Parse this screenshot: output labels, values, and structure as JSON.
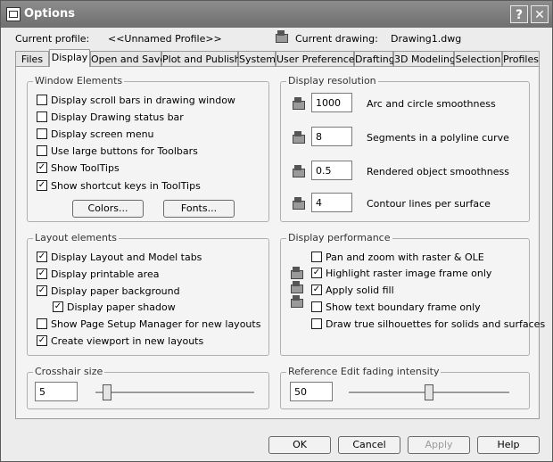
{
  "window": {
    "title": "Options",
    "help_glyph": "?",
    "close_glyph": "✕"
  },
  "header": {
    "profile_label": "Current profile:",
    "profile_value": "<<Unnamed Profile>>",
    "drawing_label": "Current drawing:",
    "drawing_value": "Drawing1.dwg"
  },
  "tabs": [
    "Files",
    "Display",
    "Open and Save",
    "Plot and Publish",
    "System",
    "User Preferences",
    "Drafting",
    "3D Modeling",
    "Selection",
    "Profiles"
  ],
  "active_tab": "Display",
  "window_elements": {
    "title": "Window Elements",
    "items": [
      {
        "label": "Display scroll bars in drawing window",
        "checked": false
      },
      {
        "label": "Display Drawing status bar",
        "checked": false
      },
      {
        "label": "Display screen menu",
        "checked": false
      },
      {
        "label": "Use large buttons for Toolbars",
        "checked": false
      },
      {
        "label": "Show ToolTips",
        "checked": true
      },
      {
        "label": "Show shortcut keys in ToolTips",
        "checked": true
      }
    ],
    "colors_button": "Colors...",
    "fonts_button": "Fonts..."
  },
  "display_resolution": {
    "title": "Display resolution",
    "items": [
      {
        "value": "1000",
        "label": "Arc and circle smoothness"
      },
      {
        "value": "8",
        "label": "Segments in a polyline curve"
      },
      {
        "value": "0.5",
        "label": "Rendered object smoothness"
      },
      {
        "value": "4",
        "label": "Contour lines per surface"
      }
    ]
  },
  "layout_elements": {
    "title": "Layout elements",
    "items": [
      {
        "label": "Display Layout and Model tabs",
        "checked": true
      },
      {
        "label": "Display printable area",
        "checked": true
      },
      {
        "label": "Display paper background",
        "checked": true
      },
      {
        "label": "Display paper shadow",
        "checked": true
      },
      {
        "label": "Show Page Setup Manager for new layouts",
        "checked": false
      },
      {
        "label": "Create viewport in new layouts",
        "checked": true
      }
    ]
  },
  "display_performance": {
    "title": "Display performance",
    "items": [
      {
        "label": "Pan and zoom with raster & OLE",
        "checked": false
      },
      {
        "label": "Highlight raster image frame only",
        "checked": true
      },
      {
        "label": "Apply solid fill",
        "checked": true
      },
      {
        "label": "Show text boundary frame only",
        "checked": false
      },
      {
        "label": "Draw true silhouettes for solids and surfaces",
        "checked": false
      }
    ]
  },
  "crosshair": {
    "title": "Crosshair size",
    "value": "5",
    "level_fraction": 0.05
  },
  "refedit": {
    "title": "Reference Edit fading intensity",
    "value": "50",
    "level_fraction": 0.5
  },
  "footer": {
    "ok": "OK",
    "cancel": "Cancel",
    "apply": "Apply",
    "help": "Help"
  },
  "check_glyph": "✓"
}
